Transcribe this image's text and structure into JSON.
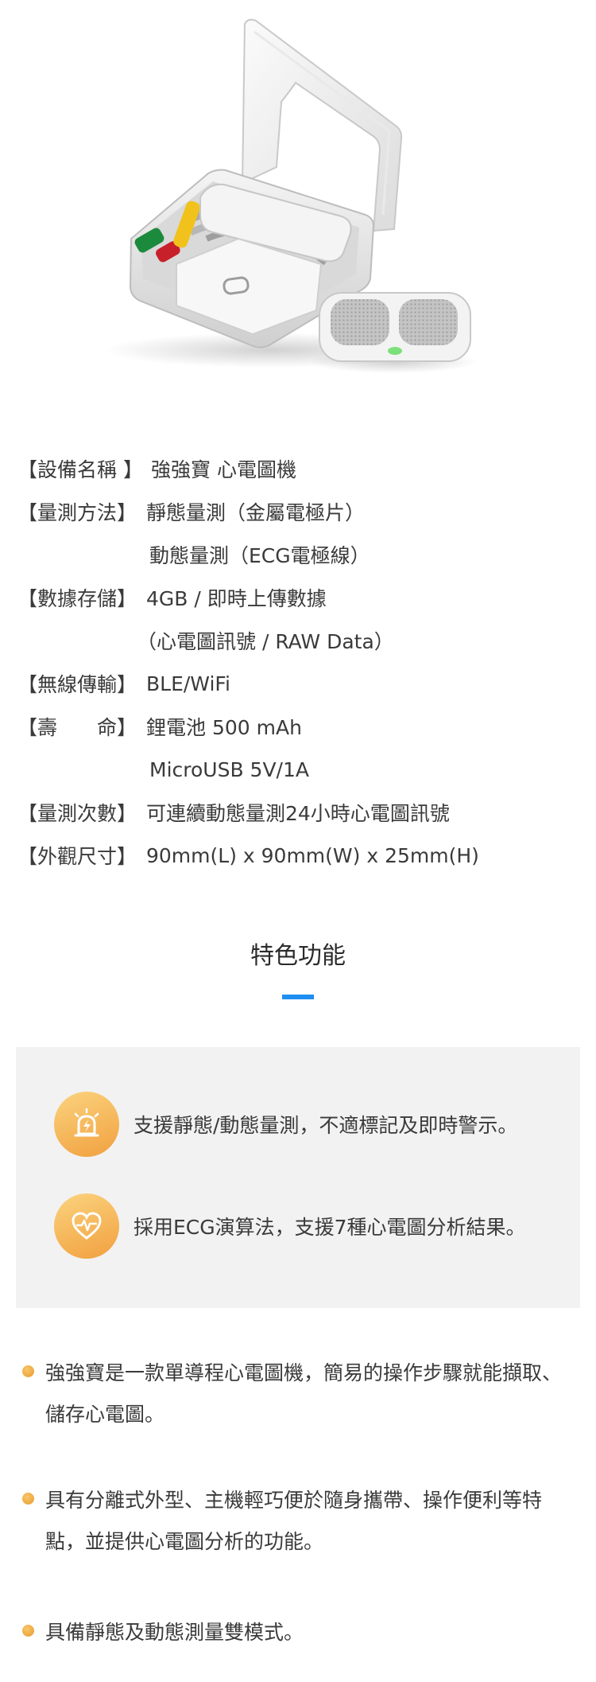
{
  "product_image": {
    "led_color": "#7be07b"
  },
  "specs": [
    {
      "label": "【設備名稱 】",
      "value": "強強寶 心電圖機"
    },
    {
      "label": "【量測方法】",
      "value": "靜態量測（金屬電極片）"
    },
    {
      "label": "",
      "value": "動態量測（ECG電極線）"
    },
    {
      "label": "【數據存儲】",
      "value": "4GB / 即時上傳數據"
    },
    {
      "label": "",
      "value": "（心電圖訊號 / RAW Data）"
    },
    {
      "label": "【無線傳輸】",
      "value": "BLE/WiFi"
    },
    {
      "label": "【壽　　命】",
      "value": "鋰電池 500 mAh"
    },
    {
      "label": "",
      "value": "MicroUSB 5V/1A"
    },
    {
      "label": "【量測次數】",
      "value": "可連續動態量測24小時心電圖訊號"
    },
    {
      "label": "【外觀尺寸】",
      "value": "90mm(L) x 90mm(W) x 25mm(H)"
    }
  ],
  "section": {
    "title": "特色功能",
    "accent_color": "#1e8ff0"
  },
  "features": [
    {
      "icon": "alarm-lightning-icon",
      "text": "支援靜態/動態量測，不適標記及即時警示。"
    },
    {
      "icon": "heart-pulse-icon",
      "text": "採用ECG演算法，支援7種心電圖分析結果。"
    }
  ],
  "bullets": [
    {
      "text": "強強寶是一款單導程心電圖機，簡易的操作步驟就能擷取、儲存心電圖。"
    },
    {
      "text": "具有分離式外型、主機輕巧便於隨身攜帶、操作便利等特點，並提供心電圖分析的功能。"
    },
    {
      "text": "具備靜態及動態測量雙模式。"
    }
  ]
}
